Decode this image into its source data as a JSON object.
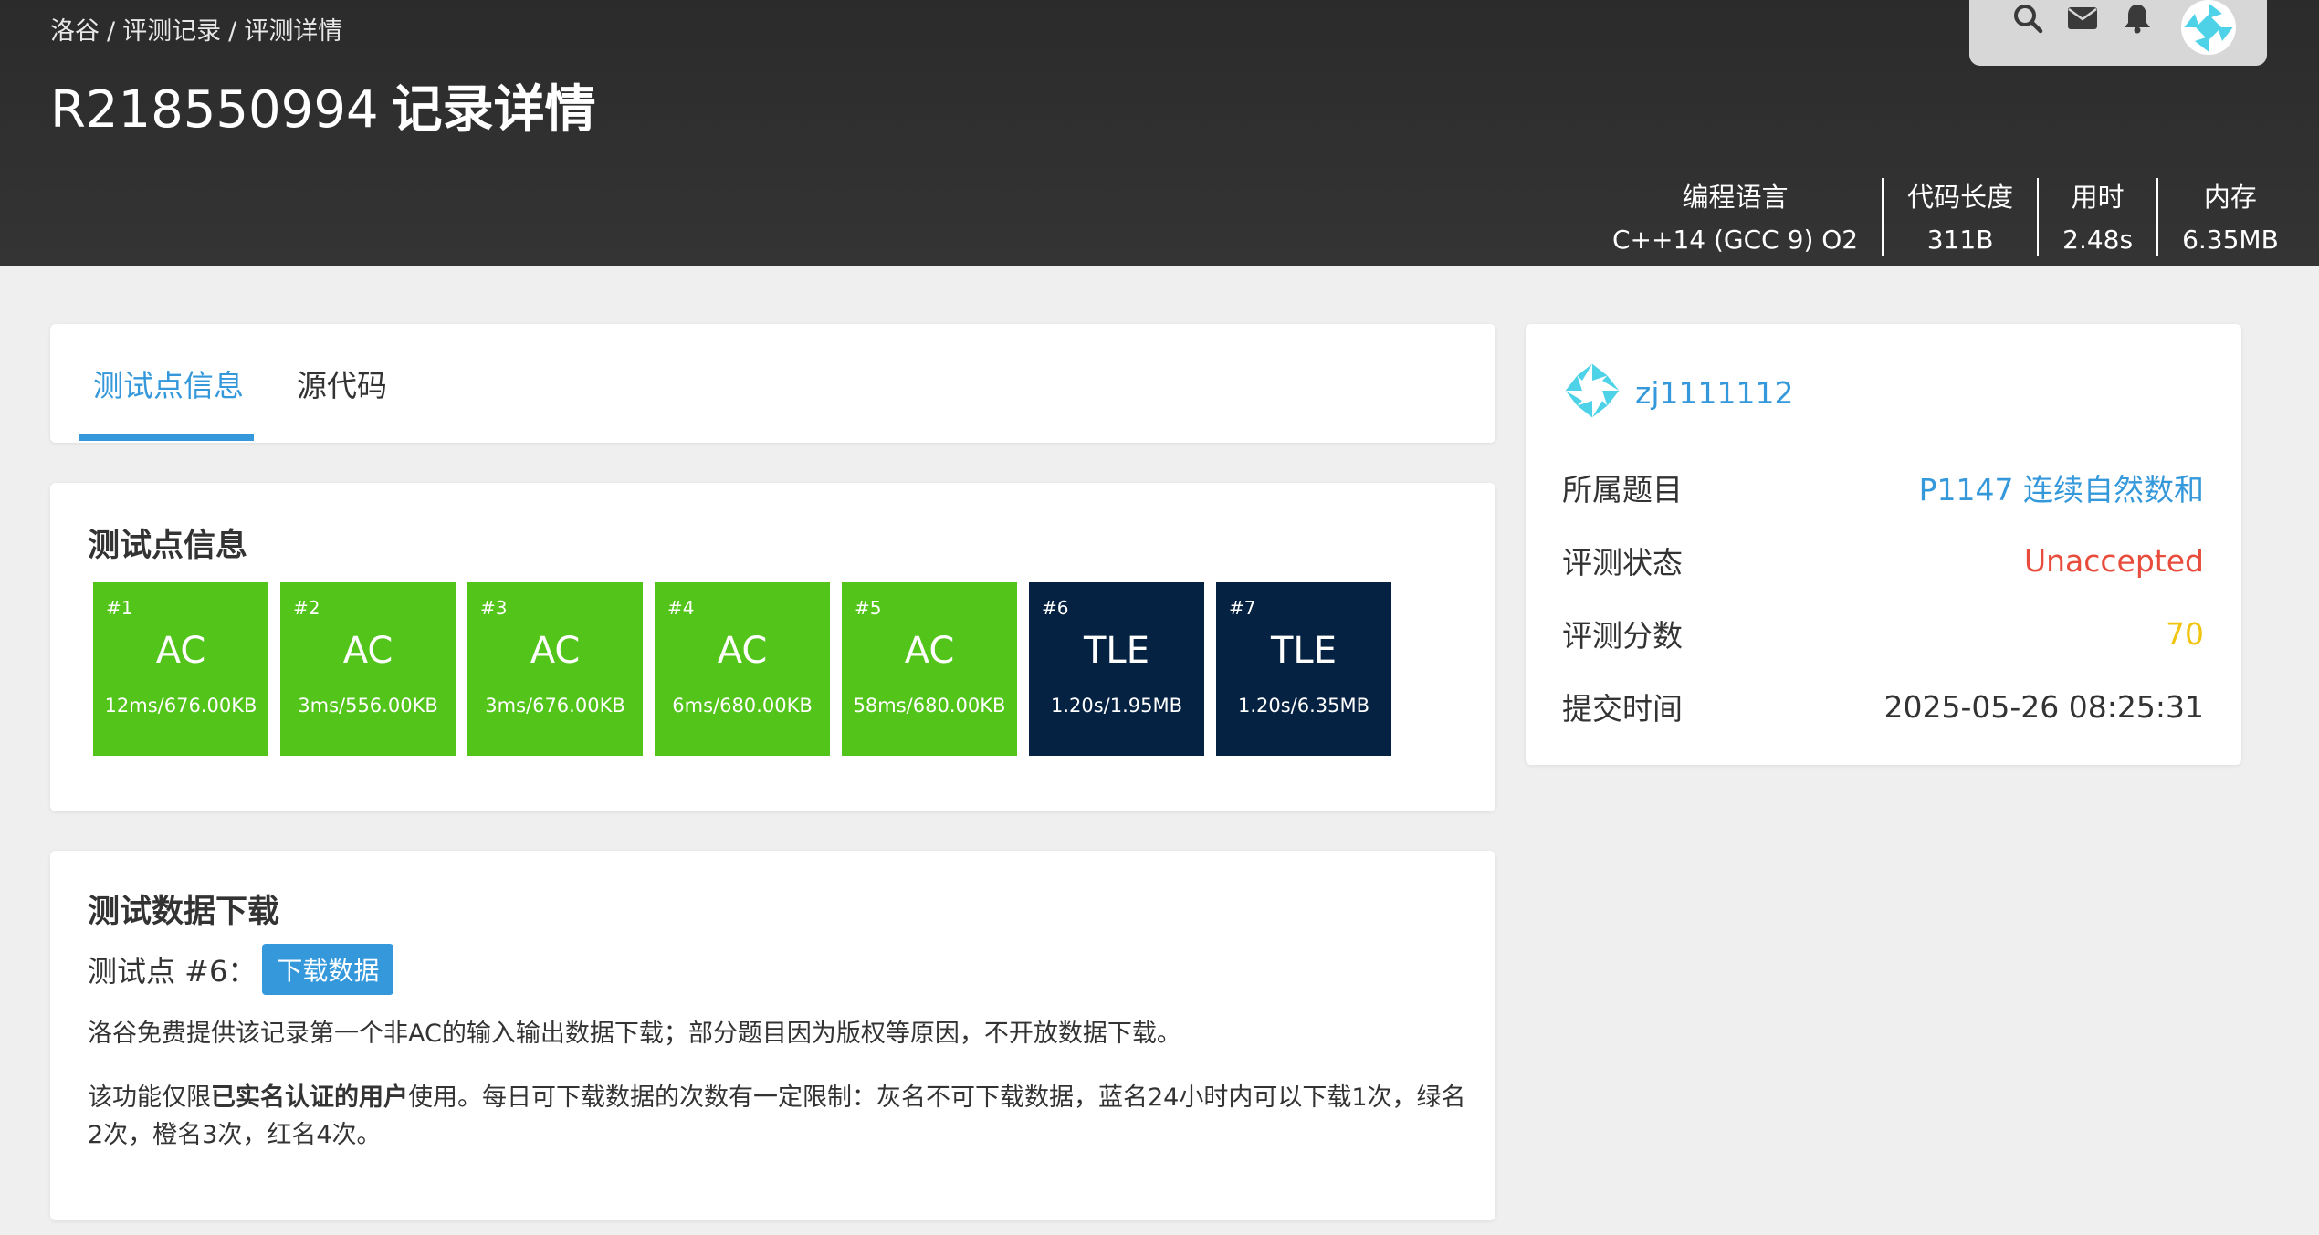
{
  "header": {
    "breadcrumb": [
      "洛谷",
      "评测记录",
      "评测详情"
    ],
    "breadcrumb_sep": "/",
    "record_id": "R218550994",
    "title": "记录详情",
    "stats": [
      {
        "label": "编程语言",
        "value": "C++14 (GCC 9) O2"
      },
      {
        "label": "代码长度",
        "value": "311B"
      },
      {
        "label": "用时",
        "value": "2.48s"
      },
      {
        "label": "内存",
        "value": "6.35MB"
      }
    ],
    "topbar_icons": [
      "search-icon",
      "mail-icon",
      "bell-icon",
      "avatar"
    ]
  },
  "tabs": [
    {
      "label": "测试点信息",
      "active": true
    },
    {
      "label": "源代码",
      "active": false
    }
  ],
  "tests": {
    "title": "测试点信息",
    "items": [
      {
        "num": "#1",
        "status": "AC",
        "info": "12ms/676.00KB"
      },
      {
        "num": "#2",
        "status": "AC",
        "info": "3ms/556.00KB"
      },
      {
        "num": "#3",
        "status": "AC",
        "info": "3ms/676.00KB"
      },
      {
        "num": "#4",
        "status": "AC",
        "info": "6ms/680.00KB"
      },
      {
        "num": "#5",
        "status": "AC",
        "info": "58ms/680.00KB"
      },
      {
        "num": "#6",
        "status": "TLE",
        "info": "1.20s/1.95MB"
      },
      {
        "num": "#7",
        "status": "TLE",
        "info": "1.20s/6.35MB"
      }
    ],
    "colors": {
      "AC": "#52c41a",
      "TLE": "#052242"
    }
  },
  "download": {
    "title": "测试数据下载",
    "point_label": "测试点 #6：",
    "button_label": "下载数据",
    "para1": "洛谷免费提供该记录第一个非AC的输入输出数据下载；部分题目因为版权等原因，不开放数据下载。",
    "para2_prefix": "该功能仅限",
    "para2_bold": "已实名认证的用户",
    "para2_suffix": "使用。每日可下载数据的次数有一定限制：灰名不可下载数据，蓝名24小时内可以下载1次，绿名2次，橙名3次，红名4次。"
  },
  "info": {
    "username": "zj1111112",
    "rows": [
      {
        "key": "所属题目",
        "value": "P1147 连续自然数和"
      },
      {
        "key": "评测状态",
        "value": "Unaccepted"
      },
      {
        "key": "评测分数",
        "value": "70"
      },
      {
        "key": "提交时间",
        "value": "2025-05-26 08:25:31"
      }
    ]
  },
  "colors": {
    "accent": "#3498db",
    "status_unaccepted": "#e74c3c",
    "score": "#f1c40f",
    "header_bg": "#2e2e2e"
  }
}
